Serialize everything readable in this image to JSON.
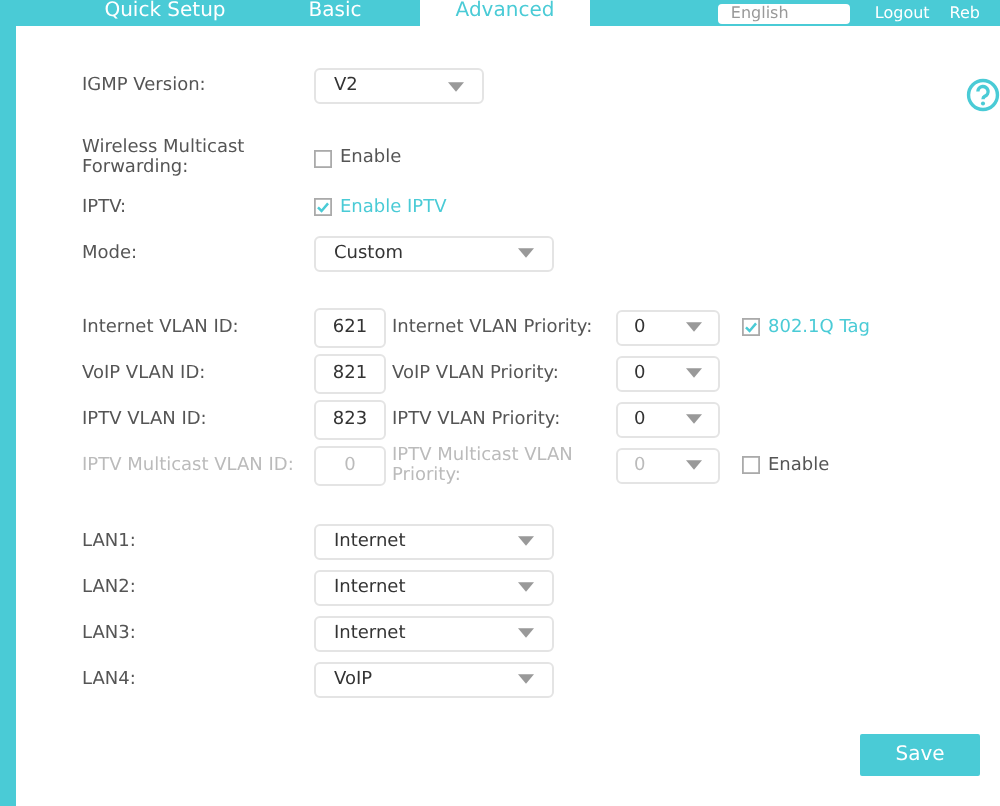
{
  "nav": {
    "tabs": [
      {
        "label": "Quick Setup",
        "selected": false
      },
      {
        "label": "Basic",
        "selected": false
      },
      {
        "label": "Advanced",
        "selected": true
      }
    ],
    "language": "English",
    "links": [
      "Logout",
      "Reb"
    ]
  },
  "igmp_version": {
    "label": "IGMP Version:",
    "value": "V2"
  },
  "wireless_multicast": {
    "label": "Wireless Multicast Forwarding:",
    "option": "Enable",
    "checked": false
  },
  "iptv": {
    "label": "IPTV:",
    "option": "Enable IPTV",
    "checked": true
  },
  "mode": {
    "label": "Mode:",
    "value": "Custom"
  },
  "vlans": [
    {
      "label": "Internet VLAN ID:",
      "id": "621",
      "priority_label": "Internet VLAN Priority:",
      "priority": "0",
      "disabled": false,
      "option": "802.1Q Tag",
      "checked": true
    },
    {
      "label": "VoIP VLAN ID:",
      "id": "821",
      "priority_label": "VoIP VLAN Priority:",
      "priority": "0",
      "disabled": false
    },
    {
      "label": "IPTV VLAN ID:",
      "id": "823",
      "priority_label": "IPTV VLAN Priority:",
      "priority": "0",
      "disabled": false
    },
    {
      "label": "IPTV Multicast VLAN ID:",
      "id": "0",
      "priority_label": "IPTV Multicast VLAN Priority:",
      "priority": "0",
      "disabled": true,
      "option": "Enable",
      "checked": false
    }
  ],
  "lans": [
    {
      "label": "LAN1:",
      "value": "Internet"
    },
    {
      "label": "LAN2:",
      "value": "Internet"
    },
    {
      "label": "LAN3:",
      "value": "Internet"
    },
    {
      "label": "LAN4:",
      "value": "VoIP"
    }
  ],
  "save_button": "Save"
}
